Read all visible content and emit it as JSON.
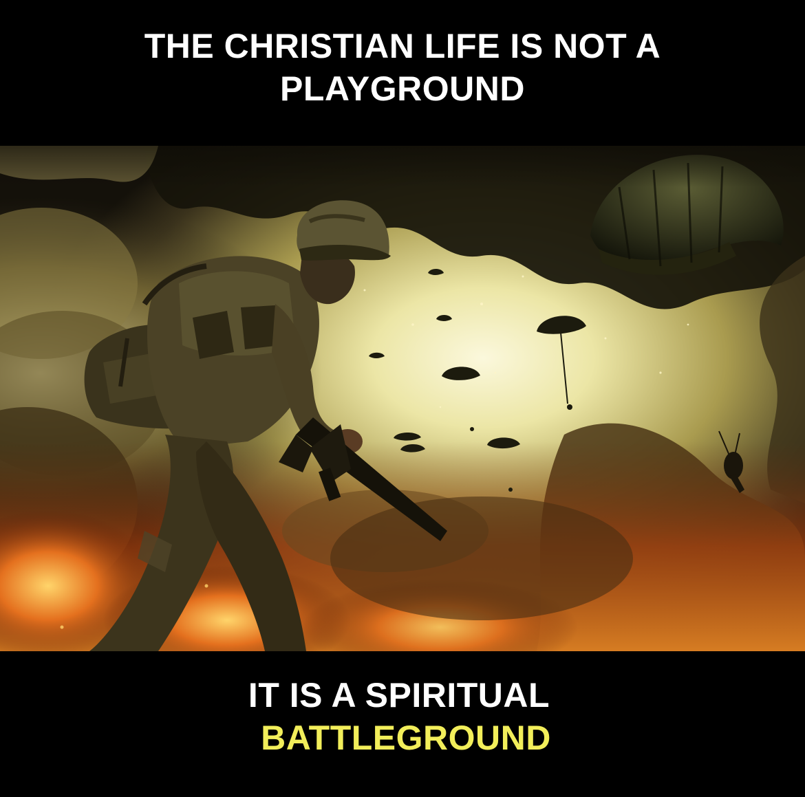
{
  "top_caption": {
    "line1": "THE CHRISTIAN LIFE IS NOT A",
    "line2": "PLAYGROUND"
  },
  "bottom_caption": {
    "line1": "IT IS A SPIRITUAL",
    "line2": "BATTLEGROUND"
  },
  "colors": {
    "background": "#000000",
    "caption_text": "#ffffff",
    "highlight_text": "#f2ee5a",
    "sky_glow": "#f4efb8",
    "fire_orange": "#d9621a",
    "smoke_dark": "#2a2416"
  },
  "photo": {
    "scene": "soldier-with-rifle-and-paratroopers"
  }
}
